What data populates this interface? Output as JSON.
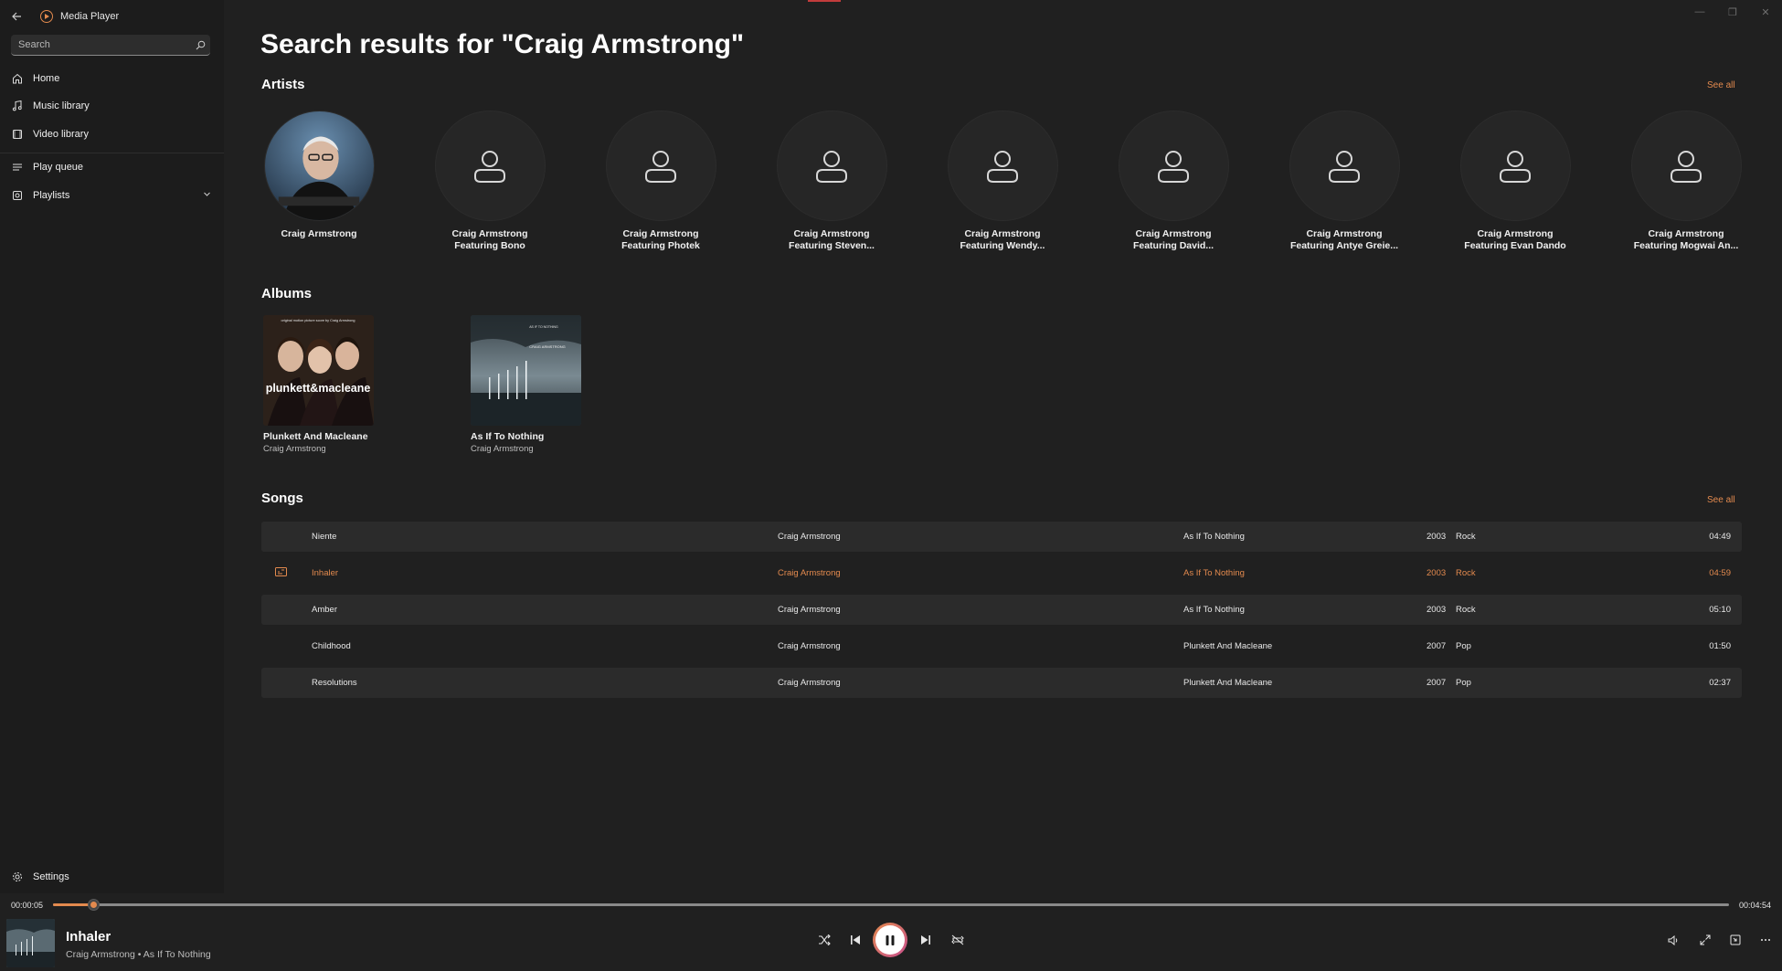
{
  "app": {
    "title": "Media Player"
  },
  "search": {
    "placeholder": "Search"
  },
  "nav": {
    "home": "Home",
    "music_library": "Music library",
    "video_library": "Video library",
    "play_queue": "Play queue",
    "playlists": "Playlists",
    "settings": "Settings"
  },
  "page": {
    "title": "Search results for \"Craig Armstrong\""
  },
  "sections": {
    "artists": "Artists",
    "albums": "Albums",
    "songs": "Songs",
    "see_all": "See all"
  },
  "artists": [
    {
      "line1": "Craig Armstrong",
      "line2": ""
    },
    {
      "line1": "Craig Armstrong",
      "line2": "Featuring Bono"
    },
    {
      "line1": "Craig Armstrong",
      "line2": "Featuring Photek"
    },
    {
      "line1": "Craig Armstrong",
      "line2": "Featuring Steven..."
    },
    {
      "line1": "Craig Armstrong",
      "line2": "Featuring Wendy..."
    },
    {
      "line1": "Craig Armstrong",
      "line2": "Featuring David..."
    },
    {
      "line1": "Craig Armstrong",
      "line2": "Featuring Antye Greie..."
    },
    {
      "line1": "Craig Armstrong",
      "line2": "Featuring Evan Dando"
    },
    {
      "line1": "Craig Armstrong",
      "line2": "Featuring Mogwai An..."
    }
  ],
  "albums": [
    {
      "title": "Plunkett And Macleane",
      "artist": "Craig Armstrong",
      "cover_text": "plunkett&macleane",
      "cover_top_text": "original motion picture score by Craig Armstrong"
    },
    {
      "title": "As If To Nothing",
      "artist": "Craig Armstrong",
      "cover_text": "CRAIG ARMSTRONG",
      "cover_top_text": "AS IF TO NOTHING"
    }
  ],
  "songs": [
    {
      "title": "Niente",
      "artist": "Craig Armstrong",
      "album": "As If To Nothing",
      "year": "2003",
      "genre": "Rock",
      "duration": "04:49"
    },
    {
      "title": "Inhaler",
      "artist": "Craig Armstrong",
      "album": "As If To Nothing",
      "year": "2003",
      "genre": "Rock",
      "duration": "04:59"
    },
    {
      "title": "Amber",
      "artist": "Craig Armstrong",
      "album": "As If To Nothing",
      "year": "2003",
      "genre": "Rock",
      "duration": "05:10"
    },
    {
      "title": "Childhood",
      "artist": "Craig Armstrong",
      "album": "Plunkett And Macleane",
      "year": "2007",
      "genre": "Pop",
      "duration": "01:50"
    },
    {
      "title": "Resolutions",
      "artist": "Craig Armstrong",
      "album": "Plunkett And Macleane",
      "year": "2007",
      "genre": "Pop",
      "duration": "02:37"
    }
  ],
  "player": {
    "current_time": "00:00:05",
    "total_time": "00:04:54",
    "progress_fraction": 0.024,
    "title": "Inhaler",
    "subtitle": "Craig Armstrong • As If To Nothing"
  },
  "colors": {
    "accent": "#e38a4e",
    "background": "#202020",
    "sidebar": "#1c1c1c"
  },
  "icons": {
    "back": "back-arrow-icon",
    "search": "search-icon",
    "home": "home-icon",
    "music": "music-note-icon",
    "video": "video-icon",
    "queue": "queue-icon",
    "playlists": "playlist-icon",
    "settings": "gear-icon",
    "person": "person-icon",
    "shuffle": "shuffle-icon",
    "previous": "previous-icon",
    "pause": "pause-icon",
    "next": "next-icon",
    "repeat_off": "repeat-off-icon",
    "volume": "volume-icon",
    "fullscreen": "fullscreen-icon",
    "mini_player": "mini-player-icon",
    "more": "more-icon"
  }
}
